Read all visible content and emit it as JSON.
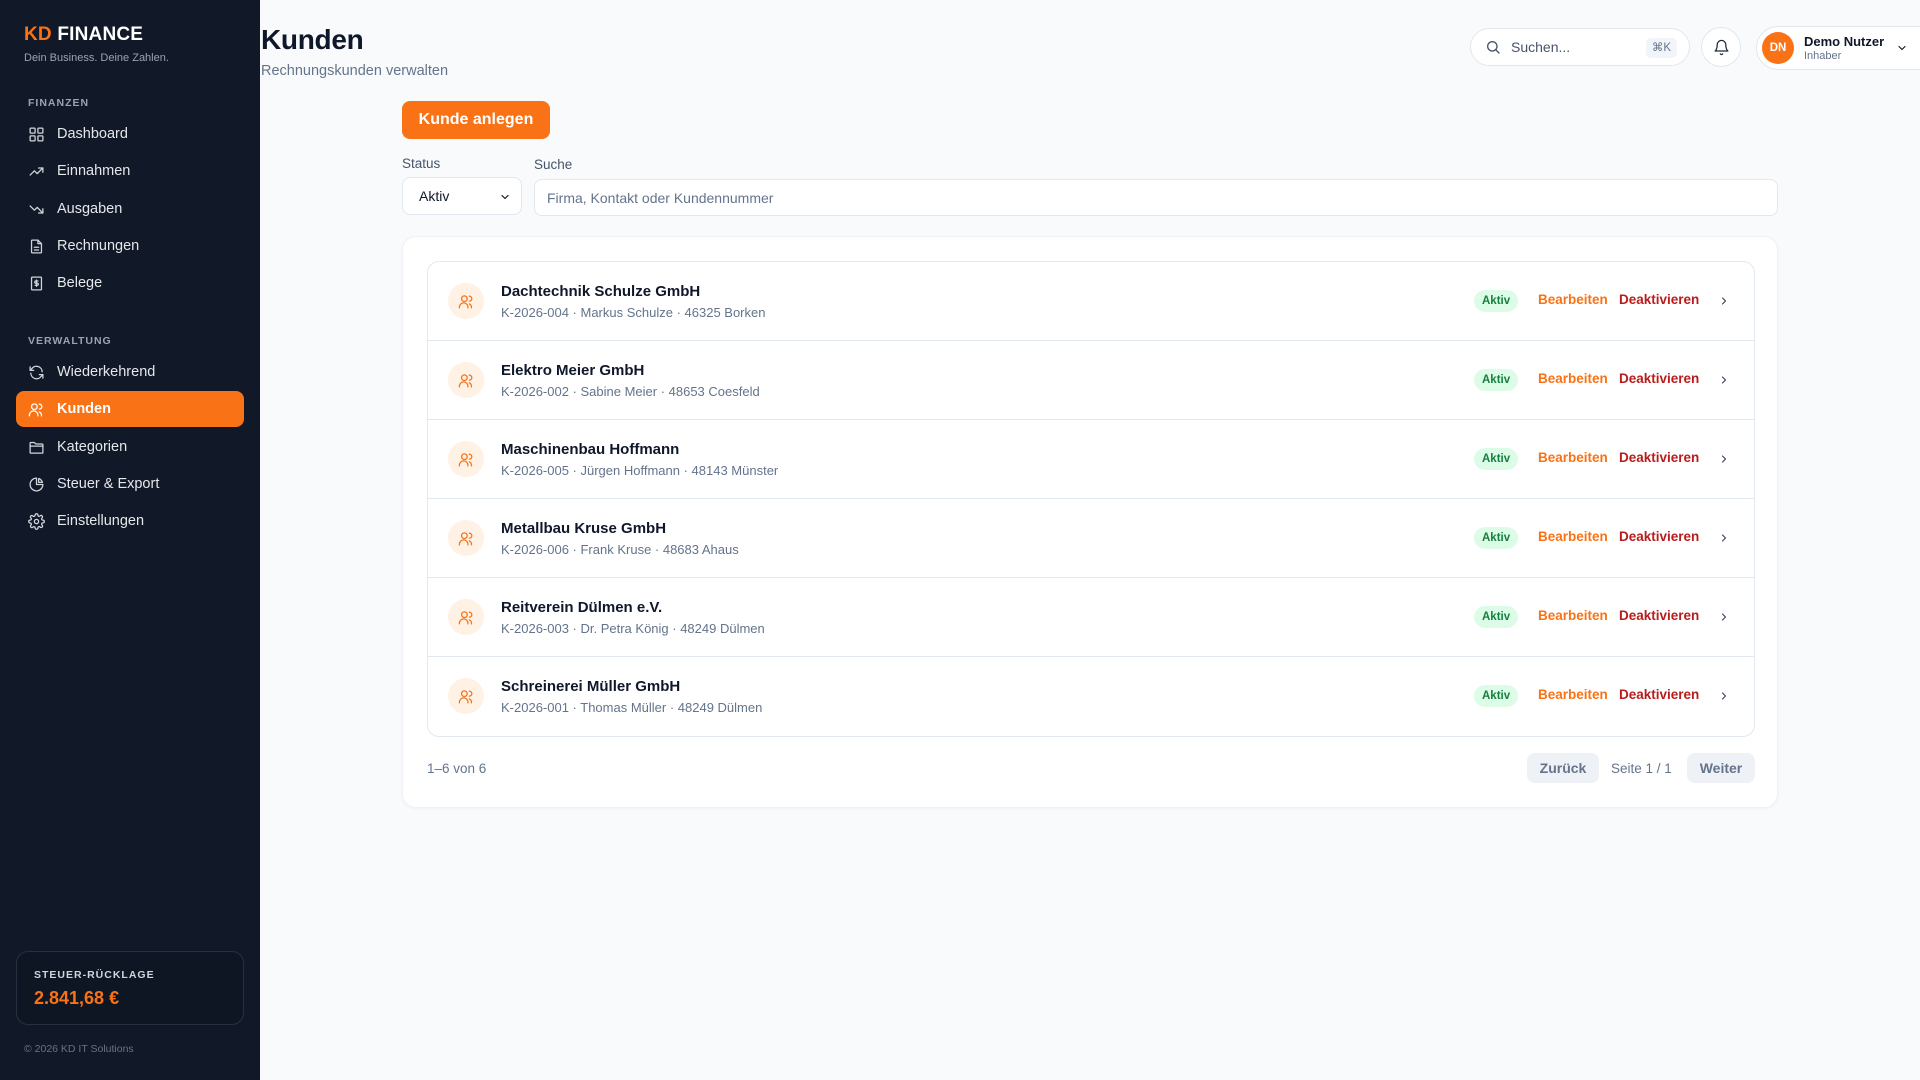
{
  "brand": {
    "kd": "KD",
    "name": "FINANCE",
    "tagline": "Dein Business. Deine Zahlen."
  },
  "sidebar": {
    "section_finance": "FINANZEN",
    "section_admin": "VERWALTUNG",
    "items": [
      {
        "label": "Dashboard",
        "icon": "dashboard-icon"
      },
      {
        "label": "Einnahmen",
        "icon": "trending-up-icon"
      },
      {
        "label": "Ausgaben",
        "icon": "trending-down-icon"
      },
      {
        "label": "Rechnungen",
        "icon": "document-icon"
      },
      {
        "label": "Belege",
        "icon": "receipt-icon"
      },
      {
        "label": "Wiederkehrend",
        "icon": "refresh-icon"
      },
      {
        "label": "Kunden",
        "icon": "users-icon",
        "active": true
      },
      {
        "label": "Kategorien",
        "icon": "folder-icon"
      },
      {
        "label": "Steuer & Export",
        "icon": "pie-chart-icon"
      },
      {
        "label": "Einstellungen",
        "icon": "gear-icon"
      }
    ],
    "reserve_label": "STEUER-RÜCKLAGE",
    "reserve_value": "2.841,68 €",
    "copyright": "© 2026 KD IT Solutions"
  },
  "header": {
    "title": "Kunden",
    "subtitle": "Rechnungskunden verwalten",
    "search_placeholder": "Suchen...",
    "shortcut": "⌘K",
    "user_initials": "DN",
    "user_name": "Demo Nutzer",
    "user_role": "Inhaber"
  },
  "toolbar": {
    "create_label": "Kunde anlegen",
    "status_label": "Status",
    "status_value": "Aktiv",
    "search_label": "Suche",
    "search_placeholder": "Firma, Kontakt oder Kundennummer"
  },
  "customers": [
    {
      "name": "Dachtechnik Schulze GmbH",
      "meta": "K-2026-004 · Markus Schulze · 46325 Borken",
      "status": "Aktiv"
    },
    {
      "name": "Elektro Meier GmbH",
      "meta": "K-2026-002 · Sabine Meier · 48653 Coesfeld",
      "status": "Aktiv"
    },
    {
      "name": "Maschinenbau Hoffmann",
      "meta": "K-2026-005 · Jürgen Hoffmann · 48143 Münster",
      "status": "Aktiv"
    },
    {
      "name": "Metallbau Kruse GmbH",
      "meta": "K-2026-006 · Frank Kruse · 48683 Ahaus",
      "status": "Aktiv"
    },
    {
      "name": "Reitverein Dülmen e.V.",
      "meta": "K-2026-003 · Dr. Petra König · 48249 Dülmen",
      "status": "Aktiv"
    },
    {
      "name": "Schreinerei Müller GmbH",
      "meta": "K-2026-001 · Thomas Müller · 48249 Dülmen",
      "status": "Aktiv"
    }
  ],
  "actions": {
    "edit": "Bearbeiten",
    "deactivate": "Deaktivieren"
  },
  "pagination": {
    "range": "1–6 von 6",
    "prev": "Zurück",
    "page": "Seite 1 / 1",
    "next": "Weiter"
  },
  "colors": {
    "accent": "#f97316",
    "sidebar_bg": "#111827",
    "active_badge_bg": "#dcfce7",
    "active_badge_text": "#15803d",
    "danger": "#b91c1c"
  }
}
